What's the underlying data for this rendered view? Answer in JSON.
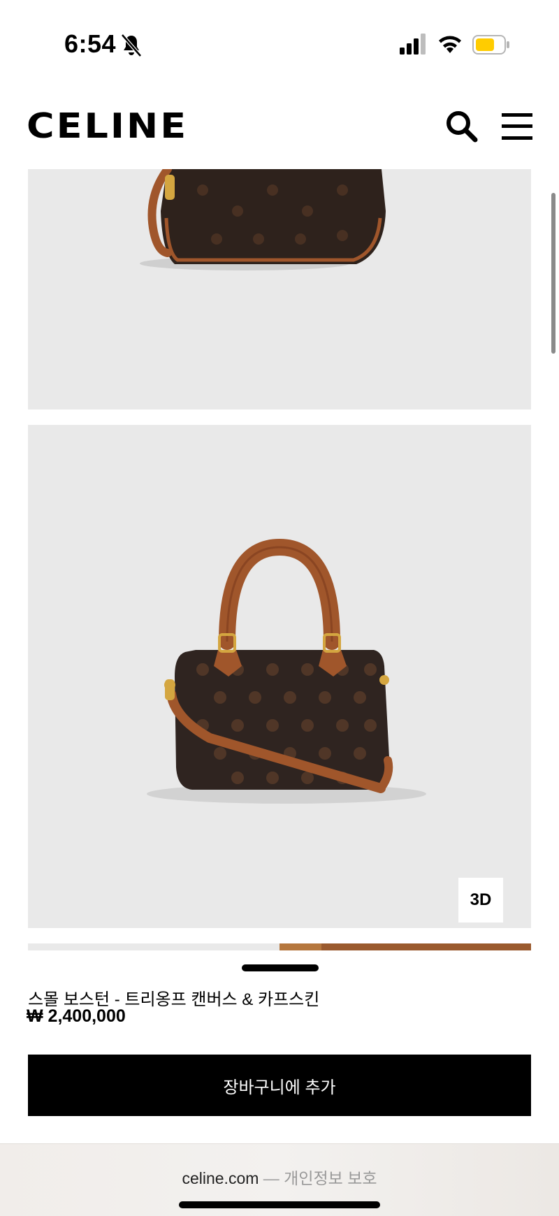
{
  "status": {
    "time": "6:54",
    "icons": [
      "bell-slash-icon",
      "signal-icon",
      "wifi-icon",
      "battery-icon"
    ],
    "battery_color": "#ffcc00"
  },
  "header": {
    "logo": "CELINE",
    "icons": [
      "search-icon",
      "hamburger-menu-icon"
    ]
  },
  "gallery": {
    "badge_3d": "3D",
    "panel_bg": "#e9e9e9"
  },
  "product": {
    "name": "스몰 보스턴 - 트리옹프 캔버스 & 카프스킨",
    "price": "₩ 2,400,000",
    "add_to_cart": "장바구니에 추가"
  },
  "browser": {
    "domain": "celine.com",
    "separator": "—",
    "page_label": "개인정보 보호"
  }
}
